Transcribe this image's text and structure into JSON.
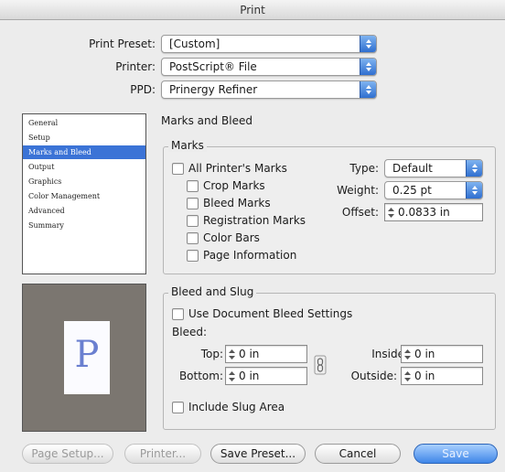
{
  "window": {
    "title": "Print"
  },
  "header": {
    "print_preset_label": "Print Preset:",
    "print_preset_value": "[Custom]",
    "printer_label": "Printer:",
    "printer_value": "PostScript® File",
    "ppd_label": "PPD:",
    "ppd_value": "Prinergy Refiner"
  },
  "sidebar": {
    "items": [
      {
        "label": "General"
      },
      {
        "label": "Setup"
      },
      {
        "label": "Marks and Bleed",
        "selected": true
      },
      {
        "label": "Output"
      },
      {
        "label": "Graphics"
      },
      {
        "label": "Color Management"
      },
      {
        "label": "Advanced"
      },
      {
        "label": "Summary"
      }
    ]
  },
  "preview": {
    "letter": "P"
  },
  "section": {
    "title": "Marks and Bleed"
  },
  "marks": {
    "group_title": "Marks",
    "all_printers_marks": "All Printer's Marks",
    "crop_marks": "Crop Marks",
    "bleed_marks": "Bleed Marks",
    "registration_marks": "Registration Marks",
    "color_bars": "Color Bars",
    "page_information": "Page Information",
    "type_label": "Type:",
    "type_value": "Default",
    "weight_label": "Weight:",
    "weight_value": "0.25 pt",
    "offset_label": "Offset:",
    "offset_value": "0.0833 in"
  },
  "bleed": {
    "group_title": "Bleed and Slug",
    "use_document": "Use Document Bleed Settings",
    "bleed_label": "Bleed:",
    "top_label": "Top:",
    "top_value": "0 in",
    "bottom_label": "Bottom:",
    "bottom_value": "0 in",
    "inside_label": "Inside:",
    "inside_value": "0 in",
    "outside_label": "Outside:",
    "outside_value": "0 in",
    "include_slug": "Include Slug Area"
  },
  "buttons": {
    "page_setup": "Page Setup...",
    "printer": "Printer...",
    "save_preset": "Save Preset...",
    "cancel": "Cancel",
    "save": "Save"
  },
  "colors": {
    "selection": "#3b73d6",
    "popup_arrow": "#2f6fd0",
    "preview_bg": "#7b7670",
    "preview_letter": "#6a7fd0"
  }
}
